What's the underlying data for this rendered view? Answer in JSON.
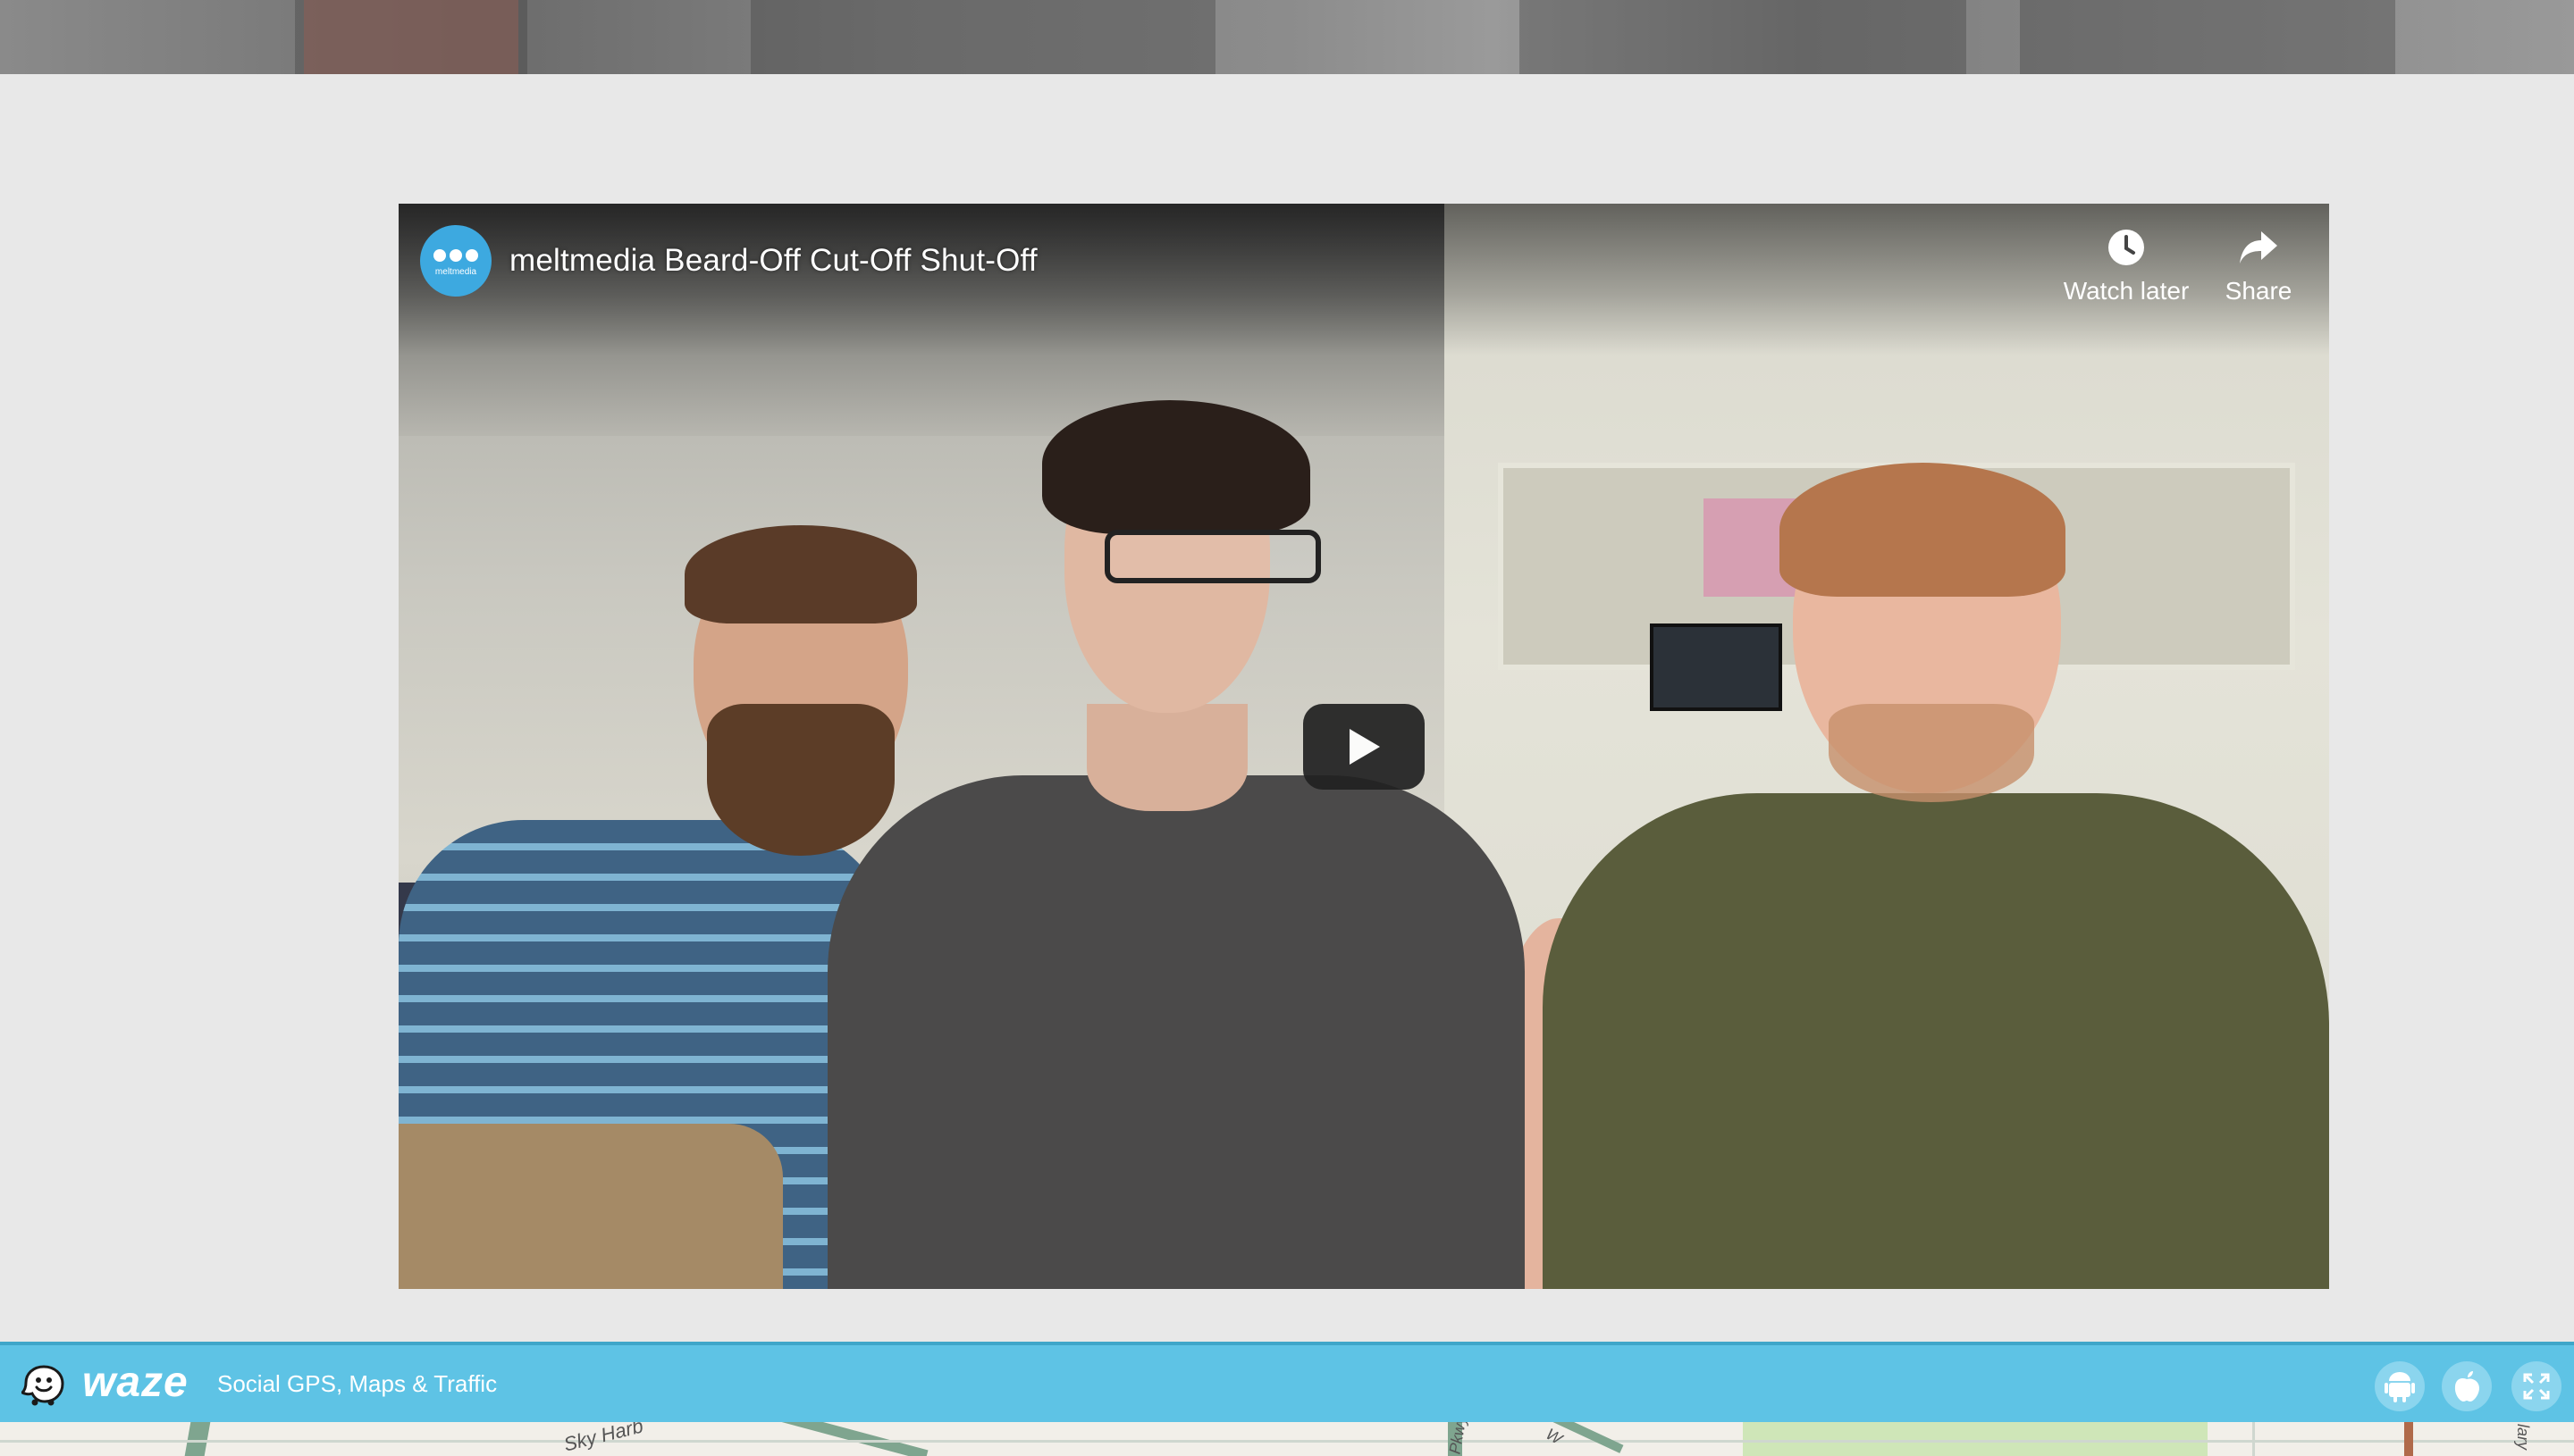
{
  "video": {
    "channel_avatar_text": "meltmedia",
    "title": "meltmedia Beard-Off Cut-Off Shut-Off",
    "watch_later_label": "Watch later",
    "share_label": "Share",
    "icons": {
      "watch_later": "clock-icon",
      "share": "share-arrow-icon",
      "play": "play-icon"
    }
  },
  "waze": {
    "wordmark": "waze",
    "tagline": "Social GPS, Maps & Traffic",
    "bar_color": "#5ec3e5",
    "icons": {
      "logo": "waze-smiley-icon",
      "android": "android-icon",
      "apple": "apple-icon",
      "expand": "expand-icon"
    }
  },
  "map": {
    "labels": [
      "Sky Harb",
      "Pkwy",
      "W",
      "lary"
    ]
  }
}
